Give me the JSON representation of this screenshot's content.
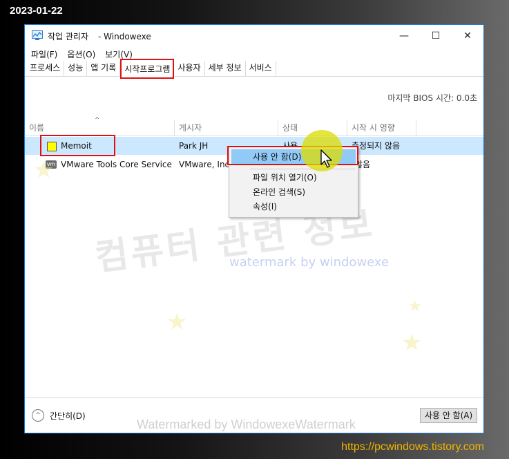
{
  "overlay": {
    "date": "2023-01-22",
    "url": "https://pcwindows.tistory.com",
    "watermark_korean": "컴퓨터 관련 정보",
    "watermark_blue": "watermark by windowexe",
    "watermark_bottom": "Watermarked by WindowexeWatermark"
  },
  "window": {
    "title": "작업 관리자",
    "title_suffix": "- Windowexe",
    "minimize_icon": "—",
    "maximize_icon": "☐",
    "close_icon": "✕"
  },
  "menu": [
    "파일(F)",
    "옵션(O)",
    "보기(V)"
  ],
  "tabs": [
    "프로세스",
    "성능",
    "앱 기록",
    "시작프로그램",
    "사용자",
    "세부 정보",
    "서비스"
  ],
  "bios_time": "마지막 BIOS 시간:  0.0초",
  "columns": [
    "이름",
    "게시자",
    "상태",
    "시작 시 영향"
  ],
  "rows": [
    {
      "name": "Memoit",
      "publisher": "Park JH",
      "status": "사용",
      "impact": "측정되지 않음"
    },
    {
      "name": "VMware Tools Core Service",
      "publisher": "VMware, Inc.",
      "status": "",
      "impact": "않음",
      "icon_text": "vm"
    }
  ],
  "context_menu": [
    "사용 안 함(D)",
    "파일 위치 열기(O)",
    "온라인 검색(S)",
    "속성(I)"
  ],
  "footer": {
    "collapse_label": "간단히(D)",
    "disable_button": "사용 안 함(A)"
  },
  "colors": {
    "accent": "#1a7be0",
    "annotation": "#e01010",
    "selection": "#cce8ff",
    "url": "#f0b400"
  }
}
